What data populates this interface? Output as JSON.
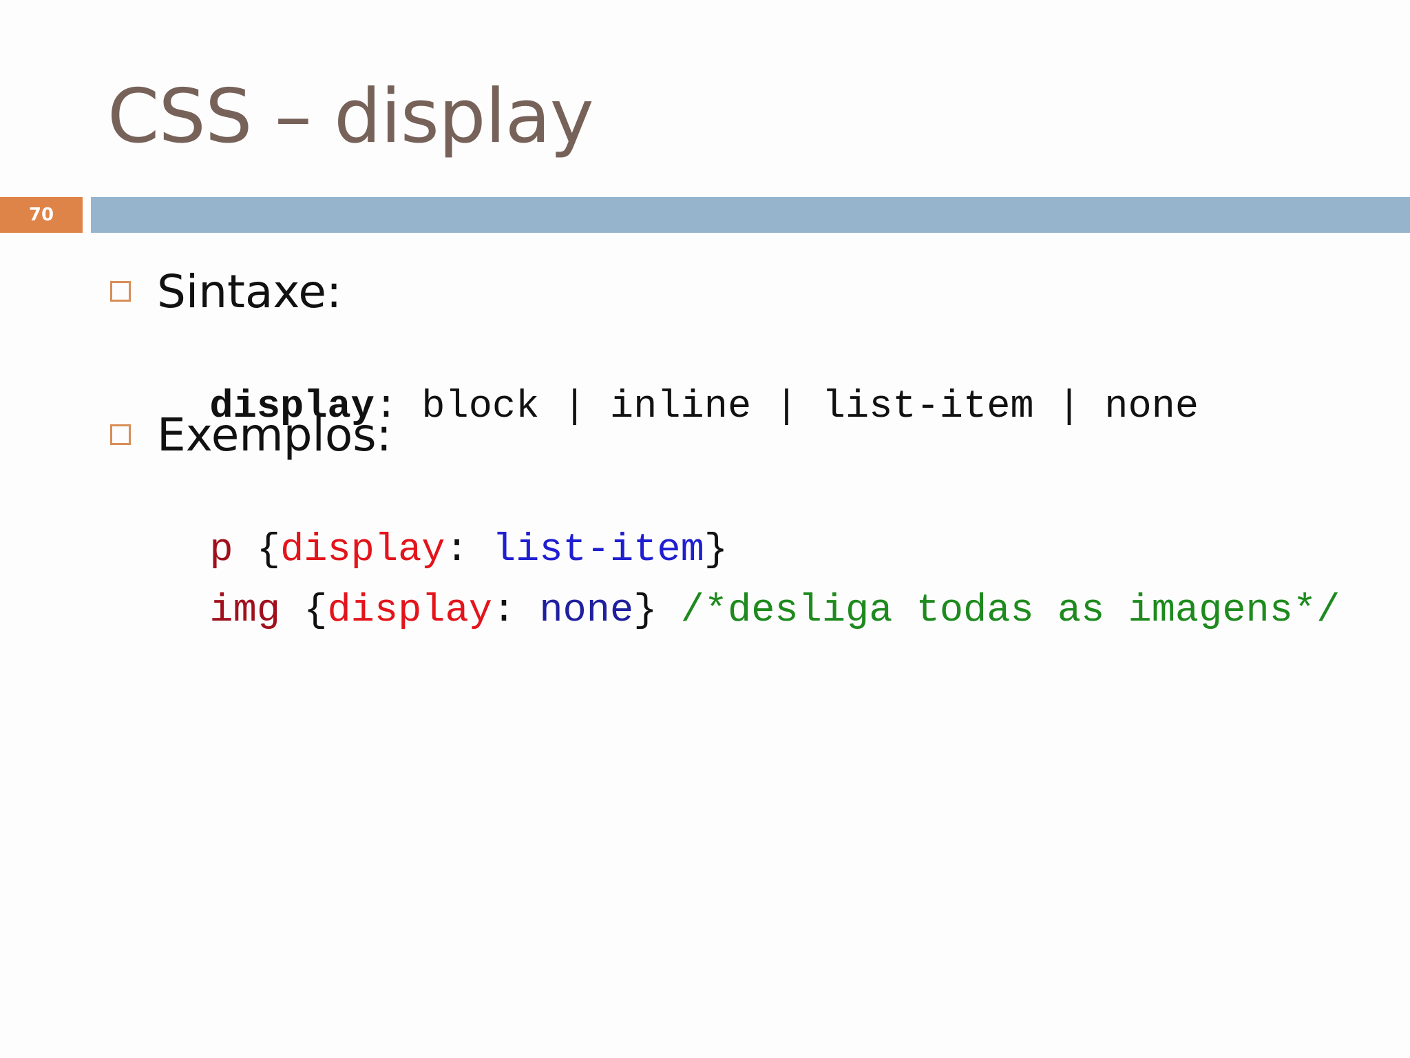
{
  "slide": {
    "title": "CSS – display",
    "number": "70"
  },
  "bullets": [
    {
      "label": "Sintaxe:",
      "lines": [
        [
          {
            "text": "display",
            "color": "#111111",
            "bold": true
          },
          {
            "text": ": block | inline | list-item | none",
            "color": "#111111",
            "bold": false
          }
        ]
      ]
    },
    {
      "label": "Exemplos:",
      "lines": [
        [
          {
            "text": "p ",
            "color": "#a0101c",
            "bold": false
          },
          {
            "text": "{",
            "color": "#111111",
            "bold": false
          },
          {
            "text": "display",
            "color": "#e3141b",
            "bold": false
          },
          {
            "text": ": ",
            "color": "#111111",
            "bold": false
          },
          {
            "text": "list-item",
            "color": "#1f1fd1",
            "bold": false
          },
          {
            "text": "}",
            "color": "#111111",
            "bold": false
          }
        ],
        [
          {
            "text": "img ",
            "color": "#a0101c",
            "bold": false
          },
          {
            "text": "{",
            "color": "#111111",
            "bold": false
          },
          {
            "text": "display",
            "color": "#e3141b",
            "bold": false
          },
          {
            "text": ": ",
            "color": "#111111",
            "bold": false
          },
          {
            "text": "none",
            "color": "#1f1f9f",
            "bold": false
          },
          {
            "text": "} ",
            "color": "#111111",
            "bold": false
          },
          {
            "text": "/*desliga todas as imagens*/",
            "color": "#1e8a1e",
            "bold": false
          }
        ]
      ]
    }
  ],
  "colors": {
    "title": "#776259",
    "accent_orange": "#df8448",
    "rule_blue": "#97b4cd",
    "bullet_box": "#d98d57"
  },
  "icons": {
    "bullet": "square-outline-bullet-icon"
  }
}
